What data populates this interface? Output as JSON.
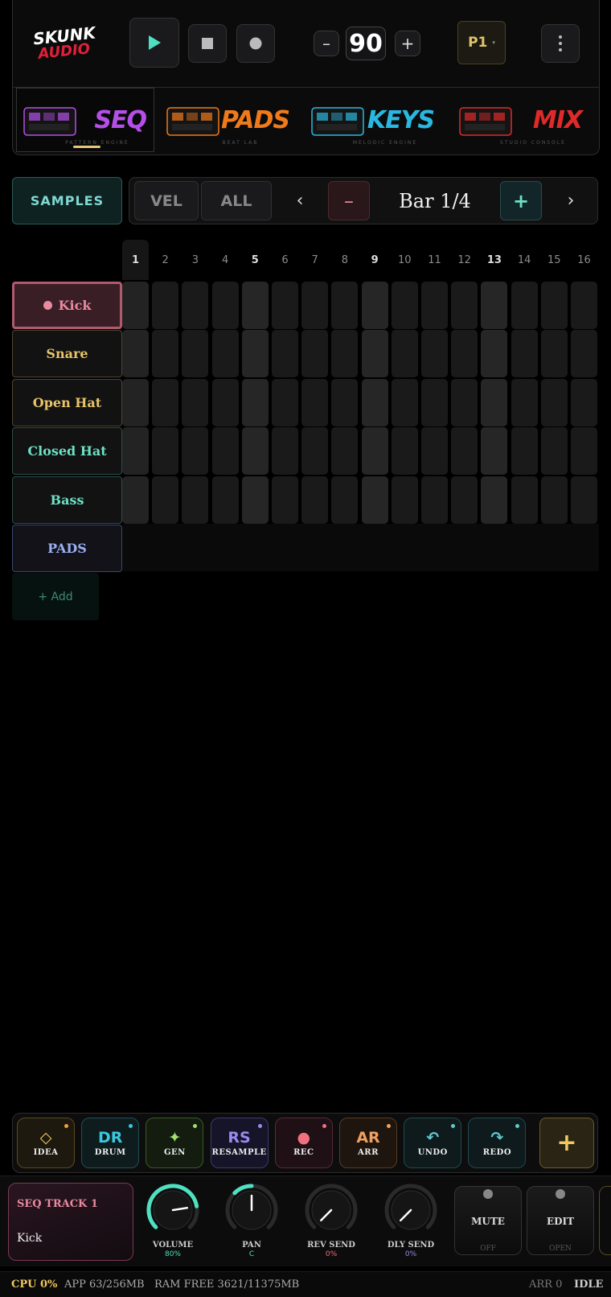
{
  "app": {
    "logo_line1": "SKUNK",
    "logo_line2": "AUDIO"
  },
  "transport": {
    "play": "play-icon",
    "stop": "stop-icon",
    "record": "record-icon",
    "bpm_minus": "–",
    "bpm": "90",
    "bpm_plus": "+",
    "pattern": "P1",
    "pattern_caret": "▾",
    "menu": "more-vertical-icon"
  },
  "tabs": [
    {
      "label": "SEQ",
      "subtitle": "PATTERN ENGINE",
      "color": "#b44fe8",
      "active": true
    },
    {
      "label": "PADS",
      "subtitle": "BEAT LAB",
      "color": "#f07a1a",
      "active": false
    },
    {
      "label": "KEYS",
      "subtitle": "MELODIC ENGINE",
      "color": "#2ab8e0",
      "active": false
    },
    {
      "label": "MIX",
      "subtitle": "STUDIO CONSOLE",
      "color": "#e02a2a",
      "active": false
    }
  ],
  "controls": {
    "samples": "SAMPLES",
    "vel": "VEL",
    "all": "ALL",
    "prev": "‹",
    "bar_minus": "–",
    "bar_label": "Bar 1/4",
    "bar_plus": "+",
    "next": "›"
  },
  "steps": [
    "1",
    "2",
    "3",
    "4",
    "5",
    "6",
    "7",
    "8",
    "9",
    "10",
    "11",
    "12",
    "13",
    "14",
    "15",
    "16"
  ],
  "tracks": [
    {
      "name": "Kick",
      "selected": true,
      "color": "#e88aa0",
      "border": "#b05a70",
      "bg": "#3a1e26"
    },
    {
      "name": "Snare",
      "selected": false,
      "color": "#e8c46a",
      "border": "#4d4530",
      "bg": "#121212"
    },
    {
      "name": "Open Hat",
      "selected": false,
      "color": "#e8c46a",
      "border": "#4d4530",
      "bg": "#121212"
    },
    {
      "name": "Closed Hat",
      "selected": false,
      "color": "#6ee0c4",
      "border": "#2b4e48",
      "bg": "#121212"
    },
    {
      "name": "Bass",
      "selected": false,
      "color": "#6ee0c4",
      "border": "#2b4e48",
      "bg": "#121212"
    },
    {
      "name": "PADS",
      "selected": false,
      "color": "#9ab0f0",
      "border": "#36466e",
      "bg": "#121218"
    }
  ],
  "add_track": "+ Add",
  "toolbar": [
    {
      "glyph": "◇",
      "label": "IDEA",
      "color": "#f0c860",
      "border": "#5a4a20",
      "bg": "#1d190e",
      "dot": "#f0a040"
    },
    {
      "glyph": "DR",
      "label": "DRUM",
      "color": "#3ac8e0",
      "border": "#1f5058",
      "bg": "#0e1c1e",
      "dot": "#3ac8e0"
    },
    {
      "glyph": "✦",
      "label": "GEN",
      "color": "#a0e070",
      "border": "#3a5a2a",
      "bg": "#131c0f",
      "dot": "#a0e070"
    },
    {
      "glyph": "RS",
      "label": "RESAMPLE",
      "color": "#9a8af0",
      "border": "#3e3a70",
      "bg": "#151428",
      "dot": "#9a8af0"
    },
    {
      "glyph": "●",
      "label": "REC",
      "color": "#f07080",
      "border": "#5a2a34",
      "bg": "#1e1014",
      "dot": "#f07080"
    },
    {
      "glyph": "AR",
      "label": "ARR",
      "color": "#f0a060",
      "border": "#5a3a22",
      "bg": "#1e150e",
      "dot": "#f0a060"
    },
    {
      "glyph": "↶",
      "label": "UNDO",
      "color": "#60c8d0",
      "border": "#1f4a50",
      "bg": "#0e1a1c",
      "dot": "#60c8d0"
    },
    {
      "glyph": "↷",
      "label": "REDO",
      "color": "#60c8d0",
      "border": "#1f4a50",
      "bg": "#0e1a1c",
      "dot": "#60c8d0"
    }
  ],
  "toolbar_add": "+",
  "strip": {
    "track_title": "SEQ TRACK 1",
    "track_name": "Kick",
    "knobs": [
      {
        "label": "VOLUME",
        "value": "80%",
        "level": 0.8,
        "color": "#4ee0c0",
        "val_color": "#4ee0c0"
      },
      {
        "label": "PAN",
        "value": "C",
        "level": 0.5,
        "color": "#4ee0c0",
        "val_color": "#4ee0c0"
      },
      {
        "label": "REV SEND",
        "value": "0%",
        "level": 0,
        "color": "#f07080",
        "val_color": "#f07080"
      },
      {
        "label": "DLY SEND",
        "value": "0%",
        "level": 0,
        "color": "#9a8af0",
        "val_color": "#9a8af0"
      }
    ],
    "mute_label": "MUTE",
    "mute_state": "OFF",
    "edit_label": "EDIT",
    "edit_state": "OPEN"
  },
  "status": {
    "cpu": "CPU 0%",
    "app_mem": "APP 63/256MB",
    "ram": "RAM FREE 3621/11375MB",
    "arr": "ARR 0",
    "state": "IDLE"
  }
}
